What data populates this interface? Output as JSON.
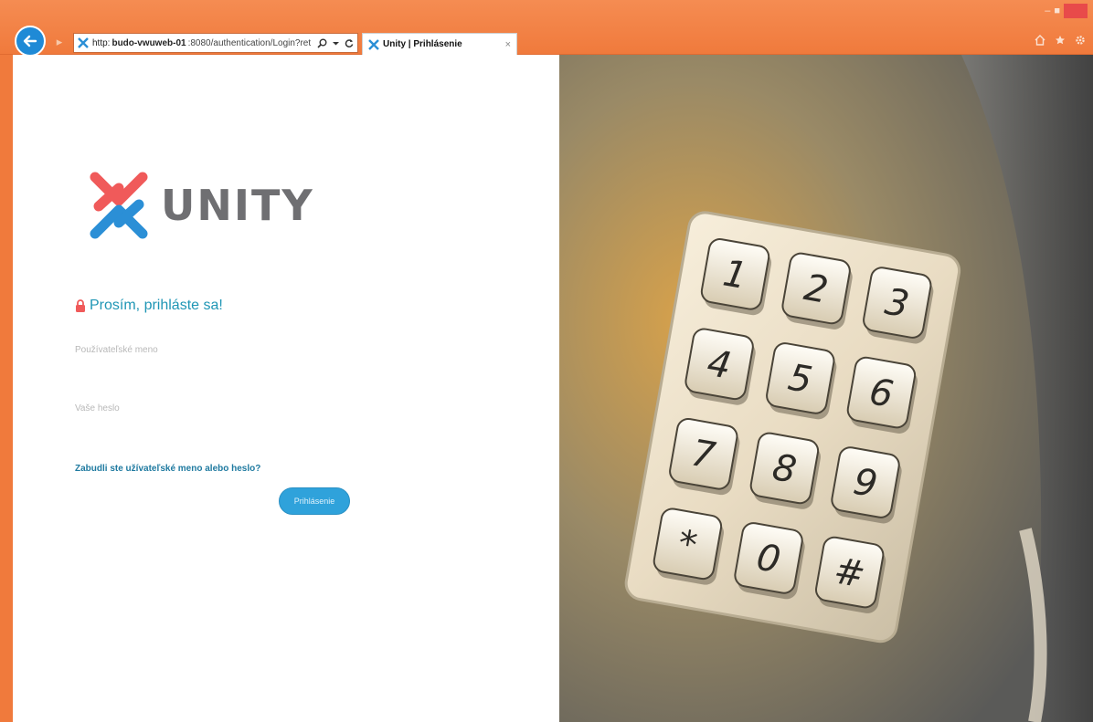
{
  "browser": {
    "url": {
      "scheme": "http:",
      "host": "budo-vwuweb-01",
      "rest": ":8080/authentication/Login?ret"
    },
    "tab_title": "Unity | Prihlásenie"
  },
  "login": {
    "logo_text": "UNITY",
    "heading": "Prosím, prihláste sa!",
    "username_placeholder": "Používateľské meno",
    "password_placeholder": "Vaše heslo",
    "forgot_link": "Zabudli ste užívateľské meno alebo heslo?",
    "submit_label": "Prihlásenie"
  },
  "keypad": {
    "keys": [
      "1",
      "2",
      "3",
      "4",
      "5",
      "6",
      "7",
      "8",
      "9",
      "*",
      "0",
      "#"
    ]
  },
  "colors": {
    "chrome": "#f07a3c",
    "accent": "#1f96b5",
    "button": "#2fa2db",
    "lock": "#f05a5a",
    "logo_red": "#f05a5a",
    "logo_blue": "#2b8fd6"
  },
  "icons": {
    "back": "back-arrow-icon",
    "lock": "lock-icon",
    "search": "search-icon",
    "refresh": "refresh-icon",
    "home": "home-icon",
    "favorites": "star-icon",
    "settings": "gear-icon"
  }
}
